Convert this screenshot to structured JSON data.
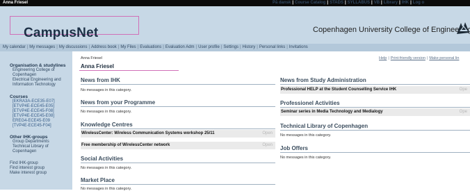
{
  "topbar": {
    "user": "Anna Friesel",
    "links": [
      "På dansk",
      "Course Catalog",
      "STADS",
      "SYLLABUS",
      "VB",
      "Library",
      "IHK",
      "Log o"
    ]
  },
  "header": {
    "logo": "CampusNet",
    "college": "Copenhagen University College of Engineering"
  },
  "nav": {
    "items": [
      "My calendar",
      "My messages",
      "My discussions",
      "Address book",
      "My Files",
      "Evaluations",
      "Evaluation Adm",
      "User profile",
      "Settings",
      "History",
      "Personal links",
      "Invitations"
    ]
  },
  "sidebar": {
    "org_title": "Organisation & studylines",
    "org_lines": [
      "Engineering College of",
      "Copenhagen",
      "Electrical Engineering and",
      "Information Technology"
    ],
    "courses_title": "Courses",
    "courses": [
      "[EKRA3A-ECE35-E07]",
      "[ETVP4E-ECE45-E05]",
      "[ETVP4E-ECE45-F08]",
      "[ETVP4E-ECE45-E08]",
      "EREG4-ECE45-E09",
      "[TVP4E-ECE45-F04]"
    ],
    "groups_title": "Other IHK-groups",
    "groups_lines": [
      "Group Departments",
      "Technical Library of",
      "Copenhagen"
    ],
    "actions": [
      "Find IHK-group",
      "Find interest group",
      "Make interest group"
    ]
  },
  "main": {
    "crumb": "Anna Friesel",
    "title": "Anna Friesel",
    "toplinks": [
      "Help",
      "Print-friendly version",
      "Make personal lin"
    ],
    "left_sections": [
      {
        "title": "News from IHK",
        "message": "No messages in this category."
      },
      {
        "title": "News from your Programme",
        "message": "No messages in this category."
      },
      {
        "title": "Knowledge Centres",
        "items": [
          {
            "text": "WirelessCenter: Wireless Communication Systems workshop 25/11",
            "status": "Open"
          },
          {
            "text": "Free membership of WirelessCenter network",
            "status": "Open"
          }
        ]
      },
      {
        "title": "Social Activities",
        "message": "No messages in this category."
      },
      {
        "title": "Market Place",
        "message": "No messages in this category."
      }
    ],
    "right_sections": [
      {
        "title": "News from Study Administration",
        "items": [
          {
            "text": "Professional HELP at the Student Counselling Service IHK",
            "status": "Ope"
          }
        ]
      },
      {
        "title": "Professionel Activities",
        "items": [
          {
            "text": "Seminar series in Media Technology and Medialogy",
            "status": "Ope"
          }
        ]
      },
      {
        "title": "Technical Library of Copenhagen",
        "message": "No messages in this category."
      },
      {
        "title": "Job Offers",
        "message": "No messages in this category."
      }
    ]
  },
  "colors": {
    "header_bg": "#c7d8e6",
    "nav_bg": "#b3c8da",
    "accent_pink": "#d070b8",
    "topbar_bg": "#0b0b0b"
  }
}
